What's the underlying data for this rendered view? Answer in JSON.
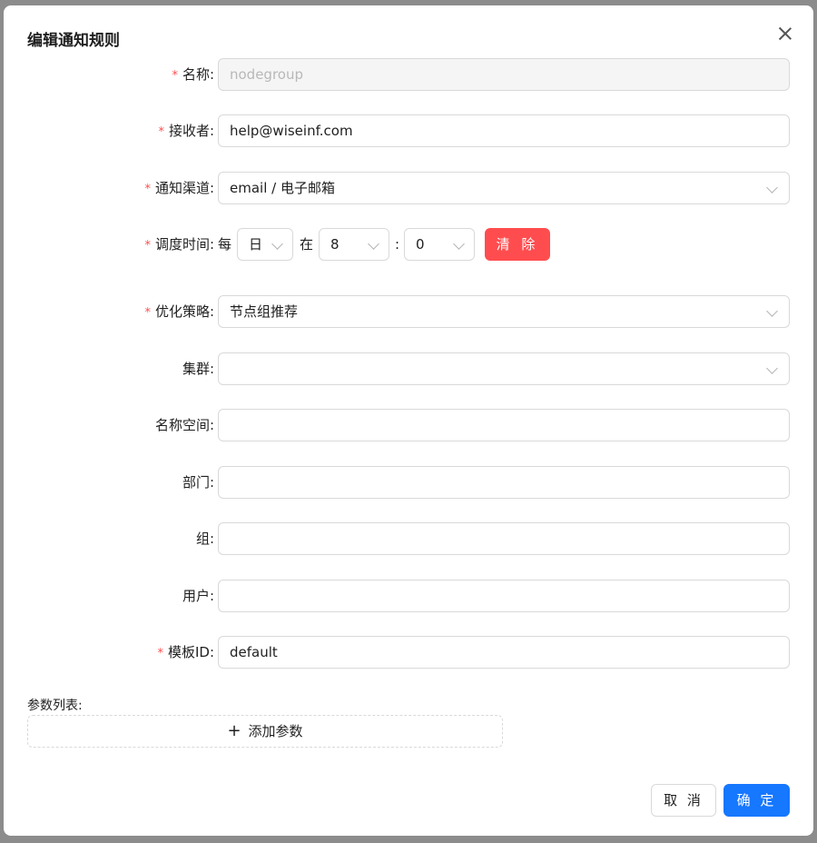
{
  "dialog": {
    "title": "编辑通知规则",
    "close_label": "关闭"
  },
  "form": {
    "name": {
      "label": "名称:",
      "required": true,
      "value": "nodegroup",
      "disabled": true
    },
    "receiver": {
      "label": "接收者:",
      "required": true,
      "value": "help@wiseinf.com"
    },
    "channel": {
      "label": "通知渠道:",
      "required": true,
      "value": "email / 电子邮箱"
    },
    "schedule": {
      "label": "调度时间:",
      "required": true,
      "prefix": "每",
      "period": "日",
      "at": "在",
      "hour": "8",
      "colon": ":",
      "minute": "0",
      "clear_label": "清 除"
    },
    "strategy": {
      "label": "优化策略:",
      "required": true,
      "value": "节点组推荐"
    },
    "cluster": {
      "label": "集群:",
      "required": false,
      "value": ""
    },
    "namespace": {
      "label": "名称空间:",
      "required": false,
      "value": ""
    },
    "department": {
      "label": "部门:",
      "required": false,
      "value": ""
    },
    "group": {
      "label": "组:",
      "required": false,
      "value": ""
    },
    "user": {
      "label": "用户:",
      "required": false,
      "value": ""
    },
    "template": {
      "label": "模板ID:",
      "required": true,
      "value": "default"
    }
  },
  "params": {
    "label": "参数列表:",
    "add_label": "添加参数"
  },
  "footer": {
    "cancel_label": "取 消",
    "ok_label": "确 定"
  },
  "colors": {
    "primary": "#1677ff",
    "danger": "#ff4d4f",
    "required": "#ff4d4f"
  }
}
